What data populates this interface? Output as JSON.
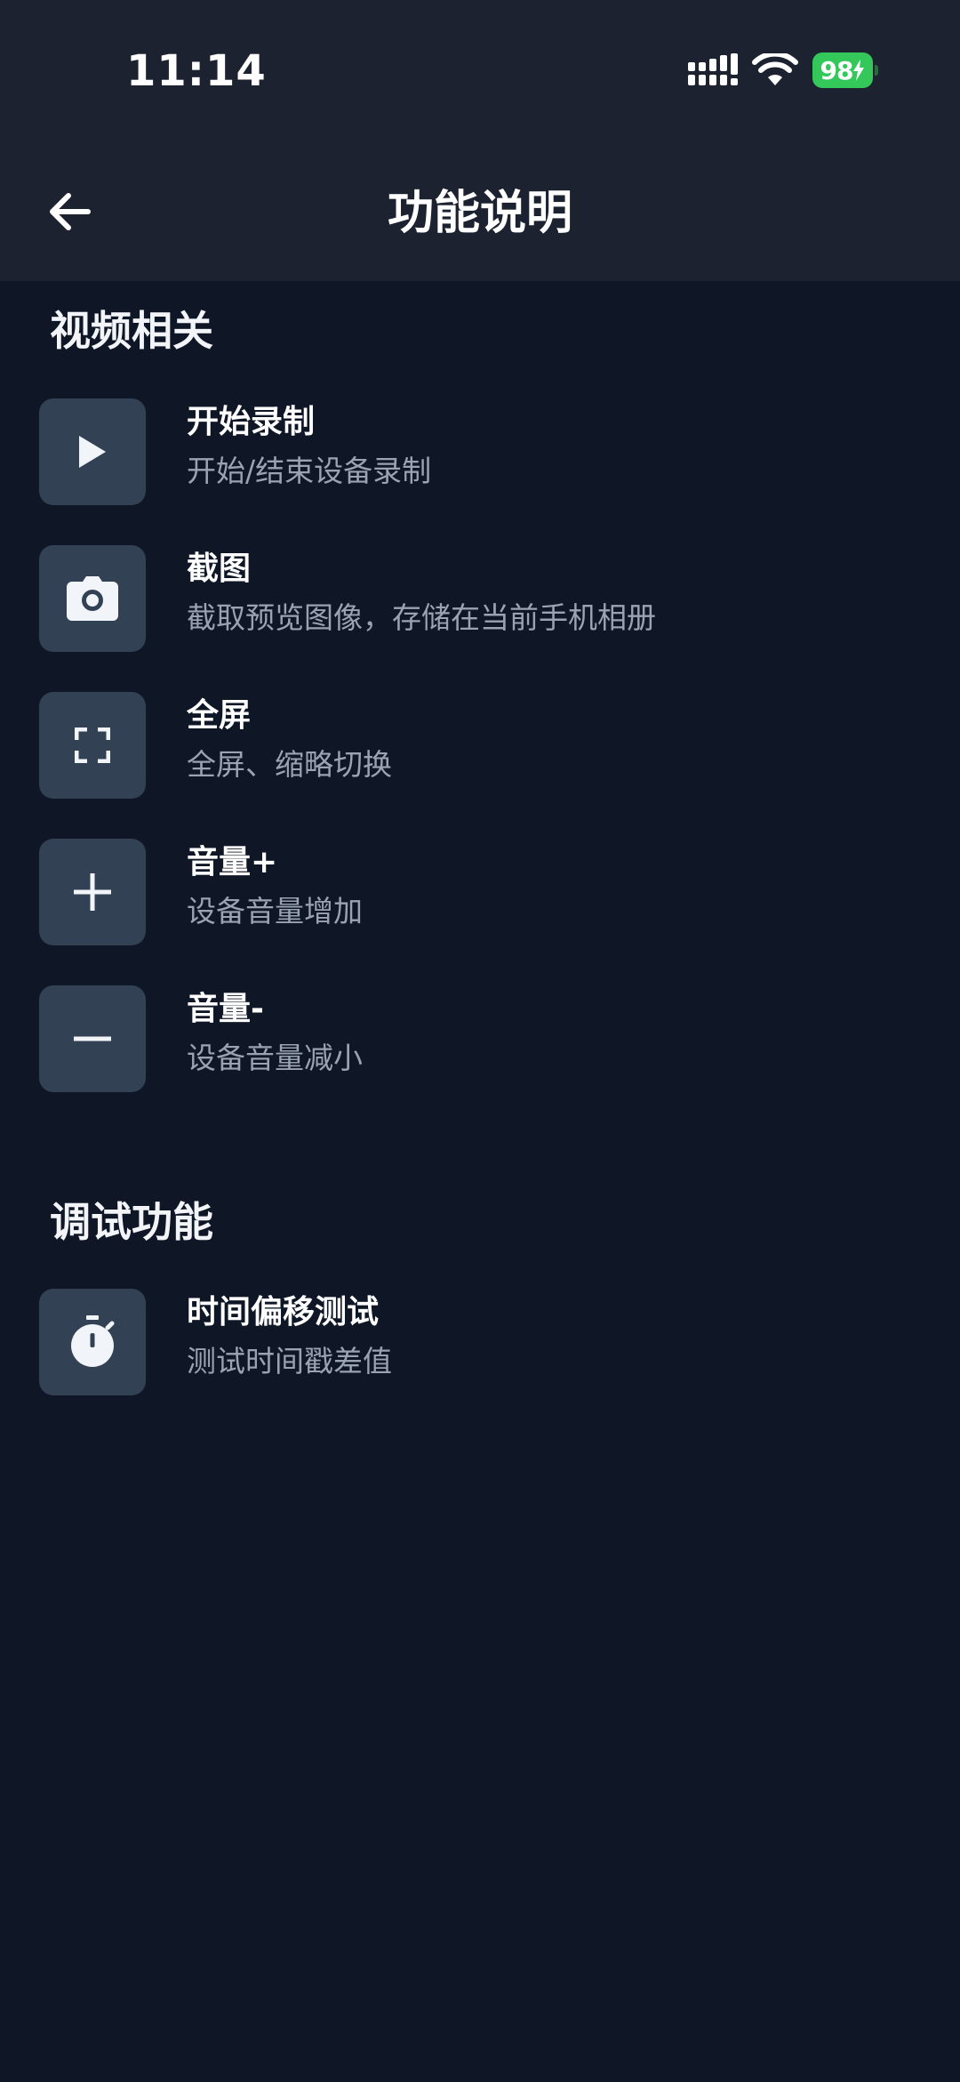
{
  "status_bar": {
    "time": "11:14",
    "battery": "98"
  },
  "header": {
    "title": "功能说明"
  },
  "sections": [
    {
      "title": "视频相关",
      "items": [
        {
          "icon": "play-icon",
          "title": "开始录制",
          "desc": "开始/结束设备录制"
        },
        {
          "icon": "camera-icon",
          "title": "截图",
          "desc": "截取预览图像，存储在当前手机相册"
        },
        {
          "icon": "fullscreen-icon",
          "title": "全屏",
          "desc": "全屏、缩略切换"
        },
        {
          "icon": "plus-icon",
          "title": "音量+",
          "desc": "设备音量增加"
        },
        {
          "icon": "minus-icon",
          "title": "音量-",
          "desc": "设备音量减小"
        }
      ]
    },
    {
      "title": "调试功能",
      "items": [
        {
          "icon": "stopwatch-icon",
          "title": "时间偏移测试",
          "desc": "测试时间戳差值"
        }
      ]
    }
  ],
  "colors": {
    "background": "#0f1727",
    "header_background": "#1c2230",
    "icon_tile": "#334155",
    "secondary_text": "#9aa3b2",
    "battery": "#34c759"
  }
}
